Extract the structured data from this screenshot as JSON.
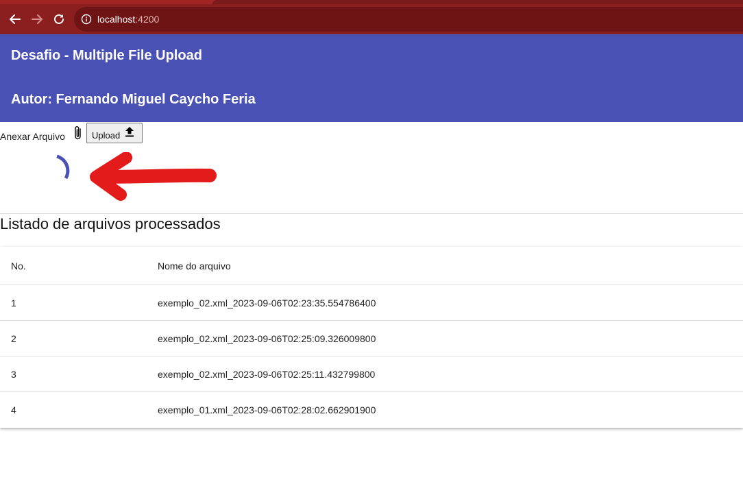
{
  "browser": {
    "url_host": "localhost",
    "url_port": ":4200"
  },
  "header": {
    "title": "Desafio - Multiple File Upload",
    "author": "Autor: Fernando Miguel Caycho Feria"
  },
  "upload": {
    "attach_label": "Anexar Arquivo",
    "button_label": "Upload"
  },
  "list": {
    "title": "Listado de arquivos processados",
    "columns": [
      "No.",
      "Nome do arquivo"
    ],
    "rows": [
      {
        "no": "1",
        "name": "exemplo_02.xml_2023-09-06T02:23:35.554786400"
      },
      {
        "no": "2",
        "name": "exemplo_02.xml_2023-09-06T02:25:09.326009800"
      },
      {
        "no": "3",
        "name": "exemplo_02.xml_2023-09-06T02:25:11.432799800"
      },
      {
        "no": "4",
        "name": "exemplo_01.xml_2023-09-06T02:28:02.662901900"
      }
    ]
  },
  "colors": {
    "browser_bar": "#8b1e1e",
    "header_bg": "#4a51b5",
    "spinner": "#4a51b5",
    "annotation_arrow": "#e41b1b"
  },
  "icons": [
    "back-arrow-icon",
    "forward-arrow-icon",
    "reload-icon",
    "info-icon",
    "paperclip-icon",
    "upload-icon",
    "loading-spinner",
    "red-arrow-annotation"
  ]
}
